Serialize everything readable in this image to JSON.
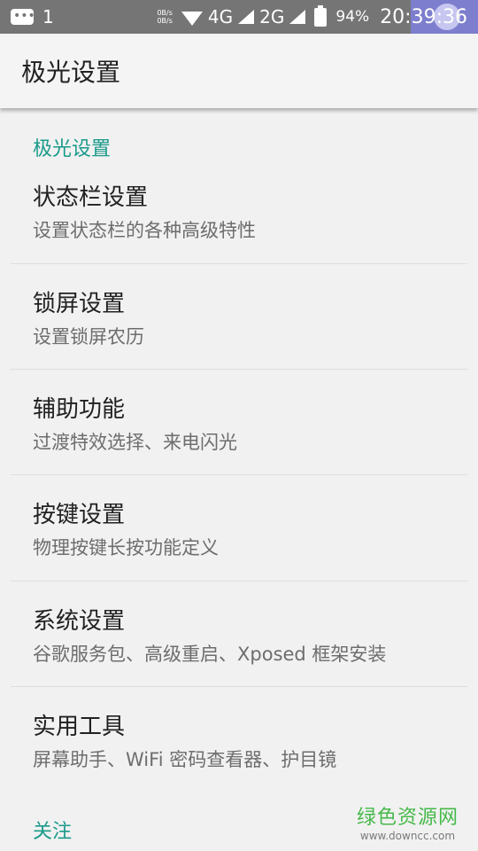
{
  "status_bar": {
    "notification_count": "1",
    "speed_up": "0B/s",
    "speed_down": "0B/s",
    "network_1": "4G",
    "network_2": "2G",
    "battery": "94%",
    "time": "20:39:36",
    "icons": [
      "message-icon",
      "wifi-icon",
      "signal-icon",
      "battery-icon"
    ]
  },
  "app_bar": {
    "title": "极光设置"
  },
  "sections": [
    {
      "header": "极光设置",
      "items": [
        {
          "title": "状态栏设置",
          "summary": "设置状态栏的各种高级特性"
        },
        {
          "title": "锁屏设置",
          "summary": "设置锁屏农历"
        },
        {
          "title": "辅助功能",
          "summary": "过渡特效选择、来电闪光"
        },
        {
          "title": "按键设置",
          "summary": "物理按键长按功能定义"
        },
        {
          "title": "系统设置",
          "summary": "谷歌服务包、高级重启、Xposed 框架安装"
        },
        {
          "title": "实用工具",
          "summary": "屏幕助手、WiFi 密码查看器、护目镜"
        }
      ]
    },
    {
      "header": "关注",
      "items": []
    }
  ],
  "watermark": {
    "main": "绿色资源网",
    "sub": "www.downcc.com"
  },
  "colors": {
    "status_bar_bg": "#757575",
    "accent": "#1a9a8a",
    "background": "#f1f1f1",
    "watermark_green": "#45b94a"
  }
}
